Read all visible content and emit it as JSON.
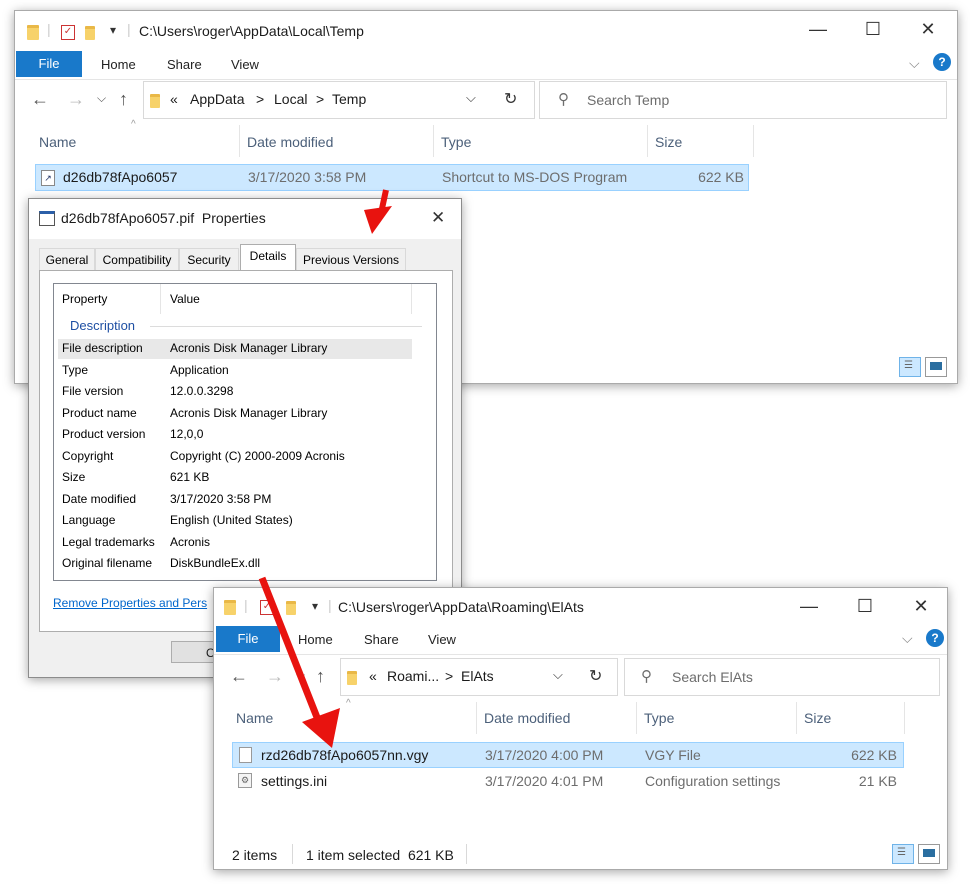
{
  "colors": {
    "accent": "#1979ca",
    "selection": "#cce8ff",
    "arrow": "#e8130f"
  },
  "explorer1": {
    "title": "C:\\Users\\roger\\AppData\\Local\\Temp",
    "ribbon": {
      "file": "File",
      "home": "Home",
      "share": "Share",
      "view": "View"
    },
    "breadcrumb": {
      "overflow": "«",
      "items": [
        "AppData",
        "Local",
        "Temp"
      ],
      "sep": ">"
    },
    "search_placeholder": "Search Temp",
    "columns": {
      "name": "Name",
      "date": "Date modified",
      "type": "Type",
      "size": "Size"
    },
    "rows": [
      {
        "name": "d26db78fApo6057",
        "date": "3/17/2020 3:58 PM",
        "type": "Shortcut to MS-DOS Program",
        "size": "622 KB",
        "selected": true
      }
    ]
  },
  "properties": {
    "title": "d26db78fApo6057.pif  Properties",
    "tabs": [
      "General",
      "Compatibility",
      "Security",
      "Details",
      "Previous Versions"
    ],
    "active_tab": "Details",
    "headers": {
      "property": "Property",
      "value": "Value"
    },
    "section": "Description",
    "rows": [
      {
        "property": "File description",
        "value": "Acronis Disk Manager Library"
      },
      {
        "property": "Type",
        "value": "Application"
      },
      {
        "property": "File version",
        "value": "12.0.0.3298"
      },
      {
        "property": "Product name",
        "value": "Acronis Disk Manager Library"
      },
      {
        "property": "Product version",
        "value": "12,0,0"
      },
      {
        "property": "Copyright",
        "value": "Copyright (C) 2000-2009 Acronis"
      },
      {
        "property": "Size",
        "value": "621 KB"
      },
      {
        "property": "Date modified",
        "value": "3/17/2020 3:58 PM"
      },
      {
        "property": "Language",
        "value": "English (United States)"
      },
      {
        "property": "Legal trademarks",
        "value": "Acronis"
      },
      {
        "property": "Original filename",
        "value": "DiskBundleEx.dll"
      }
    ],
    "remove_link": "Remove Properties and Pers",
    "ok_label": "O"
  },
  "explorer2": {
    "title": "C:\\Users\\roger\\AppData\\Roaming\\ElAts",
    "ribbon": {
      "file": "File",
      "home": "Home",
      "share": "Share",
      "view": "View"
    },
    "breadcrumb": {
      "overflow": "«",
      "items": [
        "Roami...",
        "ElAts"
      ],
      "sep": ">"
    },
    "search_placeholder": "Search ElAts",
    "columns": {
      "name": "Name",
      "date": "Date modified",
      "type": "Type",
      "size": "Size"
    },
    "rows": [
      {
        "name": "rzd26db78fApo6057nn.vgy",
        "date": "3/17/2020 4:00 PM",
        "type": "VGY File",
        "size": "622 KB",
        "selected": true
      },
      {
        "name": "settings.ini",
        "date": "3/17/2020 4:01 PM",
        "type": "Configuration settings",
        "size": "21 KB",
        "selected": false
      }
    ],
    "status": {
      "items": "2 items",
      "selected": "1 item selected  621 KB"
    }
  }
}
